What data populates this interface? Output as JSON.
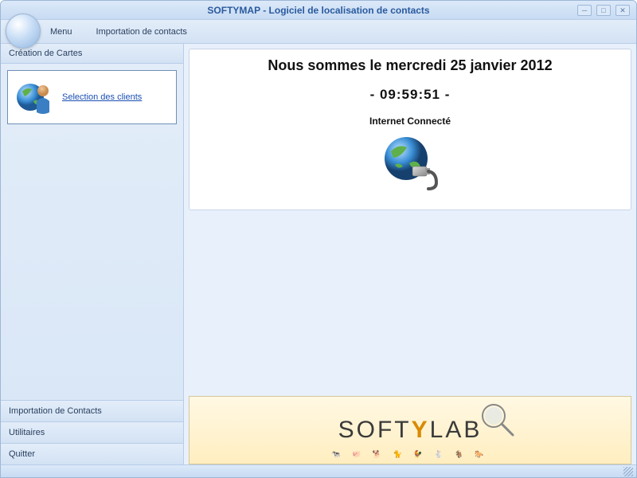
{
  "title": "SOFTYMAP - Logiciel de localisation de contacts",
  "menubar": {
    "menu": "Menu",
    "import": "Importation de contacts"
  },
  "sidebar": {
    "section_header": "Création de Cartes",
    "selection_link": "Selection des clients",
    "bottom": {
      "import_contacts": "Importation de Contacts",
      "utilities": "Utilitaires",
      "quit": "Quitter"
    }
  },
  "main": {
    "date_line": "Nous sommes le mercredi 25 janvier 2012",
    "time_line": "-  09:59:51  -",
    "status_line": "Internet Connecté"
  },
  "logo": {
    "pre": "SOFT",
    "accent": "Y",
    "post": "LAB"
  }
}
